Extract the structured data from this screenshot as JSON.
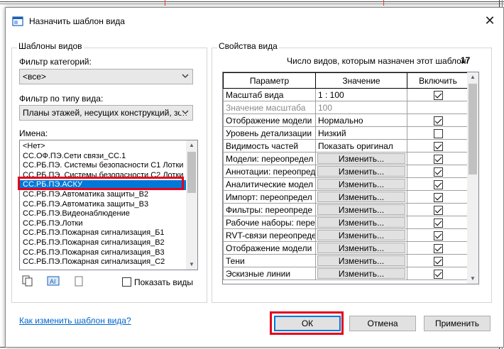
{
  "window": {
    "title": "Назначить шаблон вида",
    "close_glyph": "✕"
  },
  "left": {
    "group_title": "Шаблоны видов",
    "category_filter_label": "Фильтр категорий:",
    "category_filter_value": "<все>",
    "view_type_filter_label": "Фильтр по типу вида:",
    "view_type_filter_value": "Планы этажей, несущих конструкций, зон",
    "names_label": "Имена:",
    "names": [
      "<Нет>",
      "СС.ОФ.ПЭ.Сети связи_СС.1",
      "СС.РБ.ПЭ. Системы безопасности С1 Лотки",
      "СС.РБ.ПЭ. Системы безопасности С2 Лотки",
      "СС.РБ.ПЭ.АСКУ",
      "СС.РБ.ПЭ.Автоматика защиты_В2",
      "СС.РБ.ПЭ.Автоматика защиты_В3",
      "СС.РБ.ПЭ.Видеонаблюдение",
      "СС.РБ.ПЭ.Лотки",
      "СС.РБ.ПЭ.Пожарная сигнализация_Б1",
      "СС.РБ.ПЭ.Пожарная сигнализация_В2",
      "СС.РБ.ПЭ.Пожарная сигнализация_В3",
      "СС.РБ.ПЭ.Пожарная сигнализация_С2"
    ],
    "selected_index": 4,
    "show_views_label": "Показать виды"
  },
  "right": {
    "group_title": "Свойства вида",
    "count_label": "Число видов, которым назначен этот шаблон:",
    "count_value": "17",
    "columns": [
      "Параметр",
      "Значение",
      "Включить"
    ],
    "edit_label": "Изменить...",
    "rows": [
      {
        "param": "Масштаб вида",
        "value": "1 : 100",
        "kind": "text",
        "include": true
      },
      {
        "param": "Значение масштаба",
        "value": "100",
        "kind": "grey",
        "include": null
      },
      {
        "param": "Отображение модели",
        "value": "Нормально",
        "kind": "text",
        "include": true
      },
      {
        "param": "Уровень детализации",
        "value": "Низкий",
        "kind": "text",
        "include": false
      },
      {
        "param": "Видимость частей",
        "value": "Показать оригинал",
        "kind": "text",
        "include": true
      },
      {
        "param": "Модели: переопредел",
        "value": "",
        "kind": "button",
        "include": true
      },
      {
        "param": "Аннотации: переопред",
        "value": "",
        "kind": "button",
        "include": true
      },
      {
        "param": "Аналитические модел",
        "value": "",
        "kind": "button",
        "include": true
      },
      {
        "param": "Импорт: переопредел",
        "value": "",
        "kind": "button",
        "include": true
      },
      {
        "param": "Фильтры: переопреде",
        "value": "",
        "kind": "button",
        "include": true
      },
      {
        "param": "Рабочие наборы: пере",
        "value": "",
        "kind": "button",
        "include": true
      },
      {
        "param": "RVT-связи переопреде",
        "value": "",
        "kind": "button",
        "include": true
      },
      {
        "param": "Отображение модели",
        "value": "",
        "kind": "button",
        "include": true
      },
      {
        "param": "Тени",
        "value": "",
        "kind": "button",
        "include": true
      },
      {
        "param": "Эскизные линии",
        "value": "",
        "kind": "button",
        "include": true
      }
    ]
  },
  "footer": {
    "help_link": "Как изменить шаблон вида?",
    "ok": "ОК",
    "cancel": "Отмена",
    "apply": "Применить"
  },
  "colors": {
    "selection": "#0078d7",
    "highlight_box": "#e3001b",
    "link": "#0066cc"
  }
}
